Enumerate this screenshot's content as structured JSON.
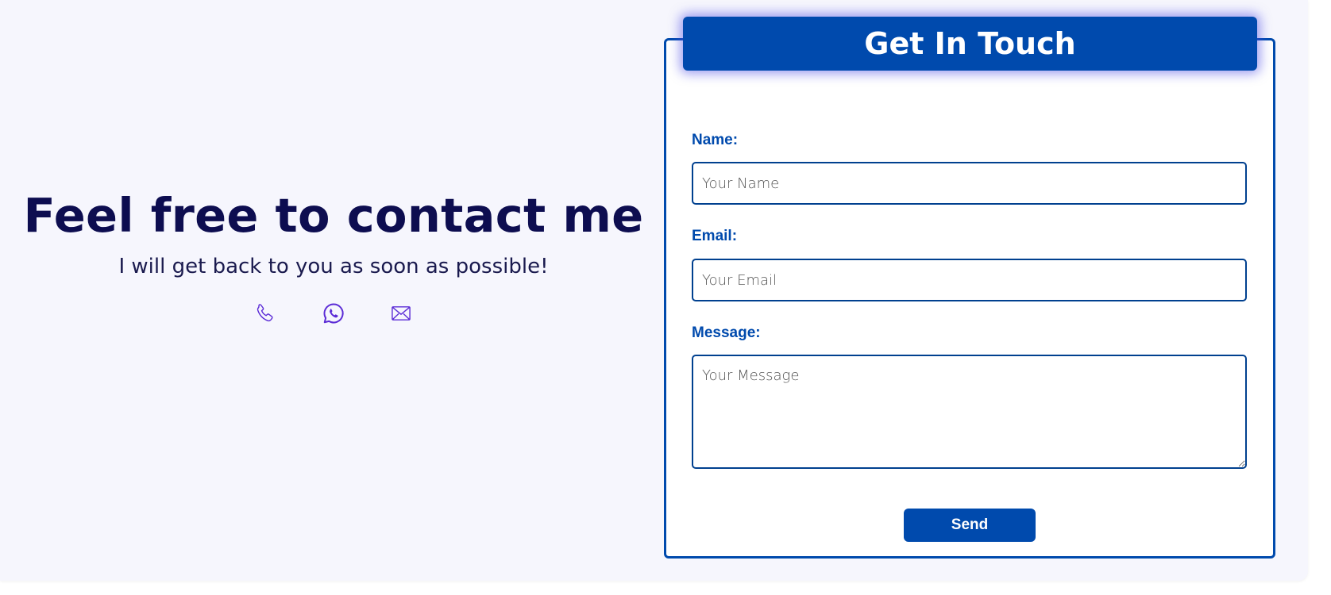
{
  "contact_intro": {
    "heading": "Feel free to contact me",
    "subtitle": "I will get back to you as soon as possible!",
    "icons": [
      {
        "name": "phone-icon"
      },
      {
        "name": "whatsapp-icon"
      },
      {
        "name": "mail-icon"
      }
    ],
    "icon_color": "#5b2bd6"
  },
  "form": {
    "title": "Get In Touch",
    "name_label": "Name:",
    "name_placeholder": "Your Name",
    "email_label": "Email:",
    "email_placeholder": "Your Email",
    "message_label": "Message:",
    "message_placeholder": "Your Message",
    "send_label": "Send"
  },
  "colors": {
    "primary": "#004aad",
    "heading_text": "#0d0d50",
    "background": "#f6f6fd"
  }
}
